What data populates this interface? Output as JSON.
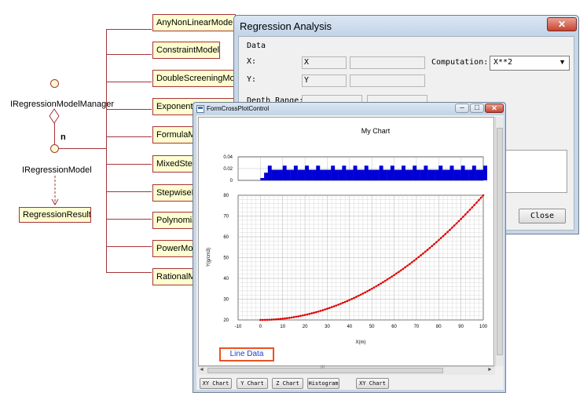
{
  "uml": {
    "manager": "IRegressionModelManager",
    "multiplicity": "n",
    "model": "IRegressionModel",
    "result": "RegressionResult",
    "classes": [
      "AnyNonLinearModel",
      "ConstraintModel",
      "DoubleScreeningModel",
      "ExponentialModel",
      "FormulaModel",
      "MixedStepwiseModel",
      "StepwiseModel",
      "PolynomialModel",
      "PowerModel",
      "RationalModel"
    ]
  },
  "regression": {
    "title": "Regression Analysis",
    "close_icon": "close-icon",
    "data_label": "Data",
    "x_label": "X:",
    "x_value": "X",
    "y_label": "Y:",
    "y_value": "Y",
    "computation_label": "Computation:",
    "computation_value": "X**2",
    "depth_label": "Depth Range:",
    "close_button": "Close"
  },
  "crossplot": {
    "title": "FormCrossPlotControl",
    "line_data_button": "Line Data",
    "scroll_mark": "III",
    "tabs": [
      "XY Chart",
      "Y Chart",
      "Z Chart",
      "Histogram",
      "XY Chart"
    ]
  },
  "chart_data": [
    {
      "type": "bar",
      "title": "My Chart",
      "xlim": [
        -10,
        100
      ],
      "ylim": [
        0,
        0.04
      ],
      "y_ticks": [
        "0.04",
        "0.02",
        "0"
      ],
      "bin_width": 1.667,
      "values": [
        0.004,
        0.013,
        0.025,
        0.018,
        0.018,
        0.018,
        0.025,
        0.018,
        0.018,
        0.025,
        0.018,
        0.018,
        0.025,
        0.018,
        0.018,
        0.025,
        0.018,
        0.018,
        0.018,
        0.025,
        0.018,
        0.018,
        0.025,
        0.018,
        0.018,
        0.025,
        0.018,
        0.018,
        0.025,
        0.018,
        0.018,
        0.018,
        0.025,
        0.018,
        0.018,
        0.025,
        0.018,
        0.018,
        0.025,
        0.018,
        0.018,
        0.025,
        0.018,
        0.018,
        0.025,
        0.018,
        0.018,
        0.018,
        0.025,
        0.018,
        0.018,
        0.025,
        0.018,
        0.018,
        0.025,
        0.018,
        0.018,
        0.025,
        0.018,
        0.018,
        0.025
      ],
      "color": "#0000d6"
    },
    {
      "type": "line",
      "xlabel": "X(m)",
      "ylabel": "Y(g/cm3)",
      "xlim": [
        -10,
        100
      ],
      "ylim": [
        20,
        80
      ],
      "x_ticks": [
        "-10",
        "0",
        "10",
        "20",
        "30",
        "40",
        "50",
        "60",
        "70",
        "80",
        "90",
        "100"
      ],
      "y_ticks": [
        "80",
        "70",
        "60",
        "50",
        "40",
        "30",
        "20"
      ],
      "grid": true,
      "formula": "y = 20 + 0.006 * x^2",
      "x_start": 0,
      "x_end": 100,
      "x_step": 1,
      "color": "#e00000"
    }
  ]
}
